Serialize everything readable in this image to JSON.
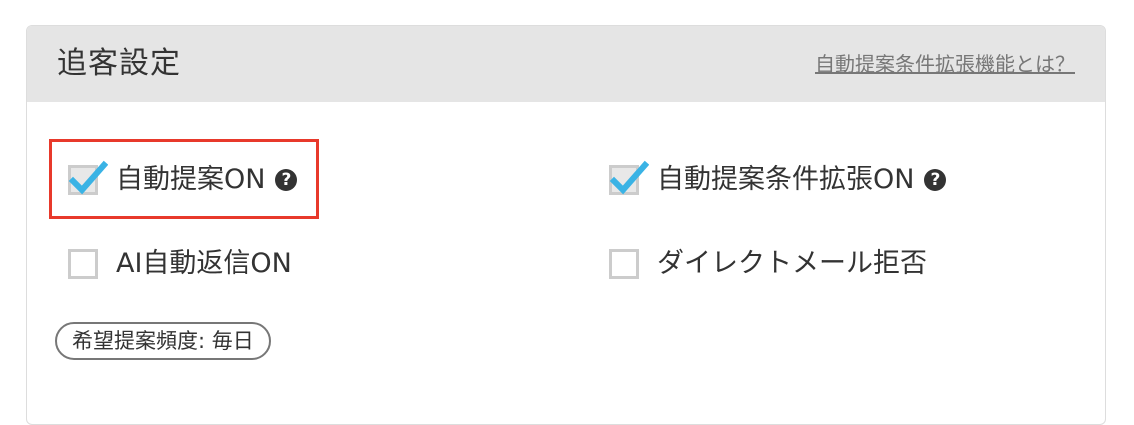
{
  "header": {
    "title": "追客設定",
    "help_link": "自動提案条件拡張機能とは？"
  },
  "options": {
    "auto_suggest": {
      "label": "自動提案ON",
      "checked": true,
      "help": "?"
    },
    "auto_suggest_extend": {
      "label": "自動提案条件拡張ON",
      "checked": true,
      "help": "?"
    },
    "ai_auto_reply": {
      "label": "AI自動返信ON",
      "checked": false
    },
    "direct_mail_reject": {
      "label": "ダイレクトメール拒否",
      "checked": false
    }
  },
  "frequency": {
    "label": "希望提案頻度: 毎日"
  },
  "colors": {
    "header_bg": "#e5e5e5",
    "check_mark": "#3ab3e5",
    "highlight": "#e8392b",
    "help_icon": "#333333"
  }
}
